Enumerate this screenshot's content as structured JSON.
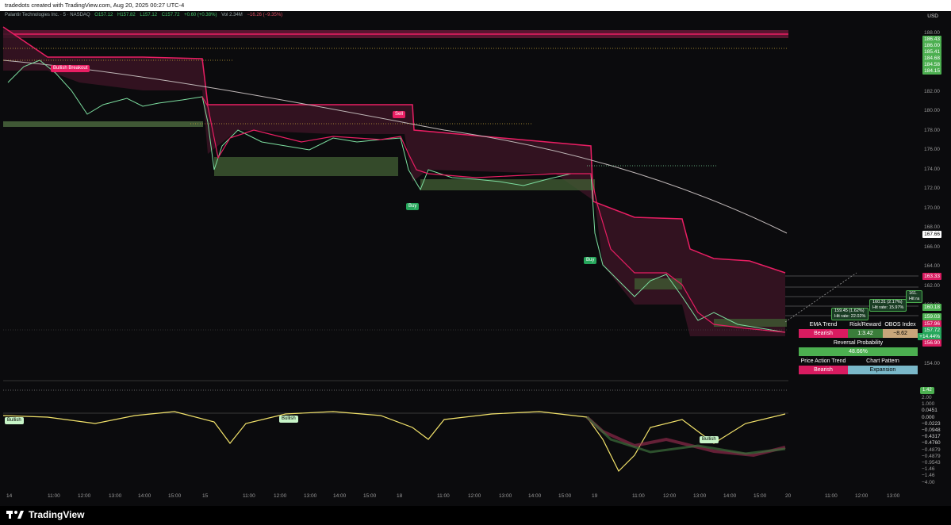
{
  "topbar": {
    "text": "tradedots created with TradingView.com, Aug 20, 2025 00:27 UTC-4"
  },
  "legend": {
    "symbol": "Palantir Technologies Inc. · 5 · NASDAQ",
    "o": "O157.12",
    "h": "H157.82",
    "l": "L157.12",
    "c": "C157.72",
    "chg": "+0.60 (+0.38%)",
    "vol": "Vol 2.34M",
    "vol_chg": "−16.26 (−9.35%)"
  },
  "price_axis": {
    "currency": "USD",
    "ticks": [
      "188.00",
      "186.00",
      "184.00",
      "182.00",
      "180.00",
      "178.00",
      "176.00",
      "174.00",
      "172.00",
      "170.00",
      "168.00",
      "166.00",
      "164.00",
      "162.00",
      "160.00",
      "158.00",
      "156.00",
      "154.00"
    ],
    "tags": [
      {
        "text": "186.43",
        "color": "#4caf50"
      },
      {
        "text": "186.00",
        "color": "#4caf50"
      },
      {
        "text": "185.41",
        "color": "#4caf50"
      },
      {
        "text": "184.68",
        "color": "#4caf50"
      },
      {
        "text": "184.58",
        "color": "#4caf50"
      },
      {
        "text": "184.15",
        "color": "#4caf50"
      },
      {
        "text": "167.66",
        "color": "#ffffff"
      },
      {
        "text": "163.33",
        "color": "#d81b60"
      },
      {
        "text": "160.18",
        "color": "#4caf50"
      },
      {
        "text": "159.03",
        "color": "#4caf50"
      },
      {
        "text": "157.96",
        "color": "#d81b60"
      },
      {
        "text": "157.72",
        "color": "#26a65b"
      },
      {
        "text": "+14.44%",
        "color": "#26a65b"
      },
      {
        "text": "156.90",
        "color": "#d81b60"
      }
    ]
  },
  "osc_axis": {
    "ticks": [
      "2.00",
      "1.000",
      "0.0451",
      "0.000",
      "−0.0223",
      "−0.0948",
      "−0.4317",
      "−0.4760",
      "−0.4879",
      "−0.4879",
      "−0.9543",
      "−1.46",
      "−1.46",
      "−4.00"
    ]
  },
  "time_axis": [
    "14",
    "11:00",
    "12:00",
    "13:00",
    "14:00",
    "15:00",
    "15",
    "11:00",
    "12:00",
    "13:00",
    "14:00",
    "15:00",
    "18",
    "11:00",
    "12:00",
    "13:00",
    "14:00",
    "15:00",
    "19",
    "11:00",
    "12:00",
    "13:00",
    "14:00",
    "15:00",
    "20",
    "11:00",
    "12:00",
    "13:00"
  ],
  "signals": {
    "breakout": "Bullish Breakout",
    "sell1": "Sell",
    "buy1": "Buy",
    "buy2": "Buy",
    "osc_bull1": "Bullish",
    "osc_bull2": "Bullish",
    "osc_bull3": "Bullish",
    "tp1": "159.45 (1.62%)",
    "tp1_hit": "Hit rate: 22.02%",
    "tp2": "160.31 (2.17%)",
    "tp2_hit": "Hit rate: 15.97%",
    "tp3": "161.",
    "tp3_hit": "Hit ra",
    "osc_val": "1.42"
  },
  "dashboard": {
    "ema_trend_label": "EMA Trend",
    "risk_reward_label": "Risk/Reward",
    "obos_label": "OBOS Index",
    "ema_trend_value": "Bearish",
    "risk_reward_value": "1:3.42",
    "obos_value": "−8.62",
    "reversal_label": "Reversal Probability",
    "reversal_value": "48.66%",
    "pat_label": "Price Action Trend",
    "chart_pattern_label": "Chart Pattern",
    "pat_value": "Bearish",
    "chart_pattern_value": "Expansion"
  },
  "brand": {
    "name": "TradingView"
  },
  "colors": {
    "bull": "#4caf50",
    "bear": "#e91e63",
    "bg": "#0b0b0d"
  }
}
